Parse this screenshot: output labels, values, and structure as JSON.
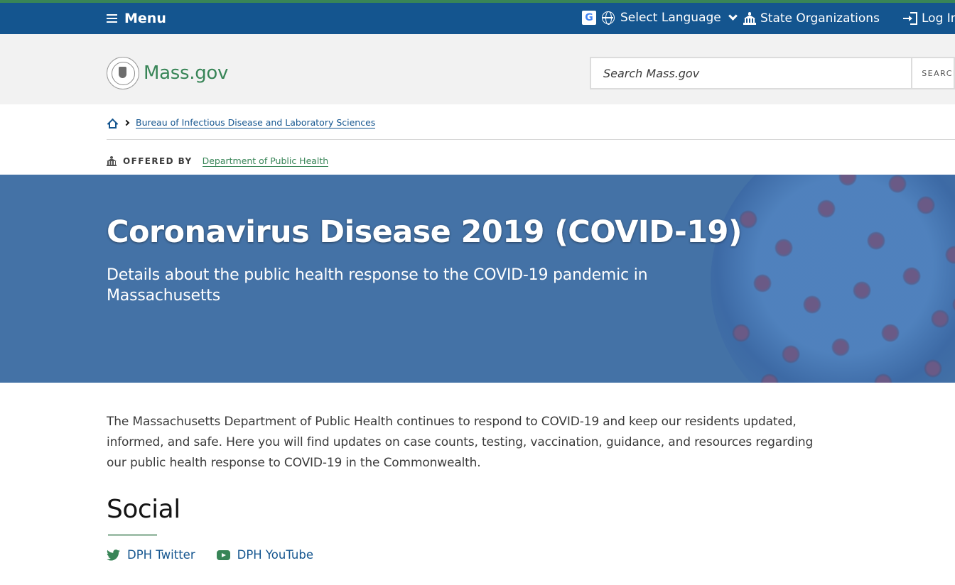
{
  "topbar": {
    "menu_label": "Menu",
    "language_label": "Select Language",
    "state_orgs_label": "State Organizations",
    "login_label": "Log In"
  },
  "header": {
    "logo_text": "Mass.gov",
    "search_placeholder": "Search Mass.gov",
    "search_button": "SEARCH"
  },
  "breadcrumb": {
    "items": [
      "Bureau of Infectious Disease and Laboratory Sciences"
    ]
  },
  "offered_by": {
    "label": "OFFERED BY",
    "org": "Department of Public Health"
  },
  "hero": {
    "title": "Coronavirus Disease 2019 (COVID-19)",
    "subtitle": "Details about the public health response to the COVID-19 pandemic in Massachusetts"
  },
  "intro": "The Massachusetts Department of Public Health continues to respond to COVID-19 and keep our residents updated, informed, and safe. Here you will find updates on case counts, testing, vaccination, guidance, and resources regarding our public health response to COVID-19 in the Commonwealth.",
  "social": {
    "heading": "Social",
    "links": [
      "DPH Twitter",
      "DPH YouTube"
    ]
  },
  "colors": {
    "topbar_bg": "#14558f",
    "accent_green": "#388557",
    "hero_bg": "#4472a6"
  }
}
